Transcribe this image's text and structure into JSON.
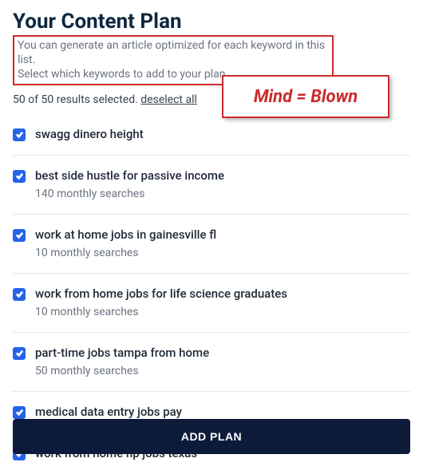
{
  "header": {
    "title": "Your Content Plan",
    "subtitle_line1": "You can generate an article optimized for each keyword in this list.",
    "subtitle_line2": "Select which keywords to add to your plan"
  },
  "selection": {
    "status": "50 of 50 results selected.",
    "deselect_label": "deselect all"
  },
  "annotation": {
    "text": "Mind = Blown"
  },
  "items": [
    {
      "keyword": "swagg dinero height",
      "searches": ""
    },
    {
      "keyword": "best side hustle for passive income",
      "searches": "140 monthly searches"
    },
    {
      "keyword": "work at home jobs in gainesville fl",
      "searches": "10 monthly searches"
    },
    {
      "keyword": "work from home jobs for life science graduates",
      "searches": "10 monthly searches"
    },
    {
      "keyword": "part-time jobs tampa from home",
      "searches": "50 monthly searches"
    },
    {
      "keyword": "medical data entry jobs pay",
      "searches": ""
    },
    {
      "keyword": "work from home np jobs texas",
      "searches": ""
    }
  ],
  "footer": {
    "add_plan_label": "ADD PLAN"
  },
  "colors": {
    "accent_red": "#cc2b2b",
    "checkbox_blue": "#2563eb",
    "button_dark": "#0d1b3b"
  }
}
